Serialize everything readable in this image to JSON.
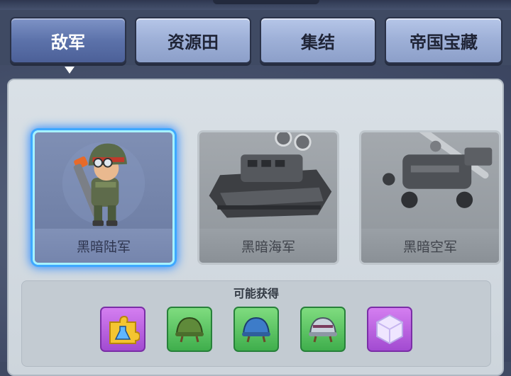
{
  "tabs": [
    {
      "label": "敌军",
      "active": true
    },
    {
      "label": "资源田",
      "active": false
    },
    {
      "label": "集结",
      "active": false
    },
    {
      "label": "帝国宝藏",
      "active": false
    }
  ],
  "units": [
    {
      "label": "黑暗陆军",
      "selected": true,
      "icon": "soldier-icon"
    },
    {
      "label": "黑暗海军",
      "selected": false,
      "icon": "armored-boat-icon"
    },
    {
      "label": "黑暗空军",
      "selected": false,
      "icon": "helicopter-icon"
    }
  ],
  "rewards": {
    "title": "可能获得",
    "items": [
      {
        "icon": "puzzle-flask-icon",
        "color": "purple"
      },
      {
        "icon": "green-helmet-icon",
        "color": "green"
      },
      {
        "icon": "blue-helmet-icon",
        "color": "green"
      },
      {
        "icon": "silver-helmet-icon",
        "color": "green"
      },
      {
        "icon": "crystal-cube-icon",
        "color": "purple"
      }
    ]
  },
  "colors": {
    "selected_glow": "#3ea8ff",
    "tab_active": "#5c72aa",
    "tab_inactive": "#9fb1d8"
  }
}
